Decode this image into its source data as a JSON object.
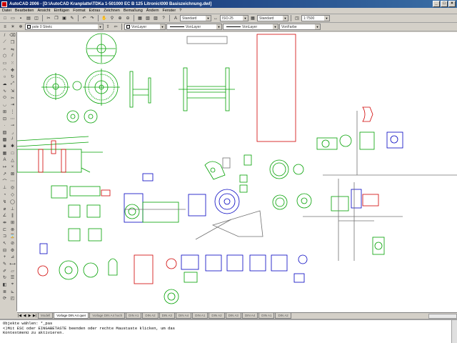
{
  "app": {
    "title": "AutoCAD 2006 - [D:\\AutoCAD Kranplatte\\TDKa 1-501000 EC B 125 Litronic\\000 Basiszeichnung.dwl]",
    "window_buttons": [
      "_",
      "□",
      "×"
    ]
  },
  "menu": {
    "items": [
      "Datei",
      "Bearbeiten",
      "Ansicht",
      "Einfügen",
      "Format",
      "Extras",
      "Zeichnen",
      "Bemaßung",
      "Ändern",
      "Fenster",
      "?"
    ]
  },
  "toolbar2": {
    "layer_name": "pole 0 Stretc",
    "color_value": "VonLayer",
    "linetype_value": "VonLayer",
    "lineweight_value": "VonLayer",
    "plotstyle_value": "VonFarbe"
  },
  "toolbar1": {
    "textstyle": "Standard",
    "dimstyle": "ISO-25",
    "tablestyle": "Standard",
    "scale": "1:7500"
  },
  "layout_tabs": [
    "Modell",
    "Vorlage DIN A4 quer",
    "Vorlage DIN A4 hoch",
    "DIN A1",
    "DIN A2",
    "DIN A3",
    "DIN A4",
    "DIN A1",
    "DIN A2",
    "DIN A3",
    "DIN A4",
    "DIN A1",
    "DIN A2",
    "DIN A3",
    "DIN A4",
    "DIN A1",
    "DIN A2"
  ],
  "command": {
    "line1": "Objekte wählen: *_pas",
    "line2": "<)Mit ESC oder EINGABETASTE beenden oder rechte Maustaste klicken, um das",
    "line3": "Kontextmenü zu aktivieren."
  },
  "colors": {
    "green": "#00a000",
    "red": "#d00000",
    "blue": "#0000c0",
    "gray": "#707070",
    "cyan": "#00a0a0"
  }
}
